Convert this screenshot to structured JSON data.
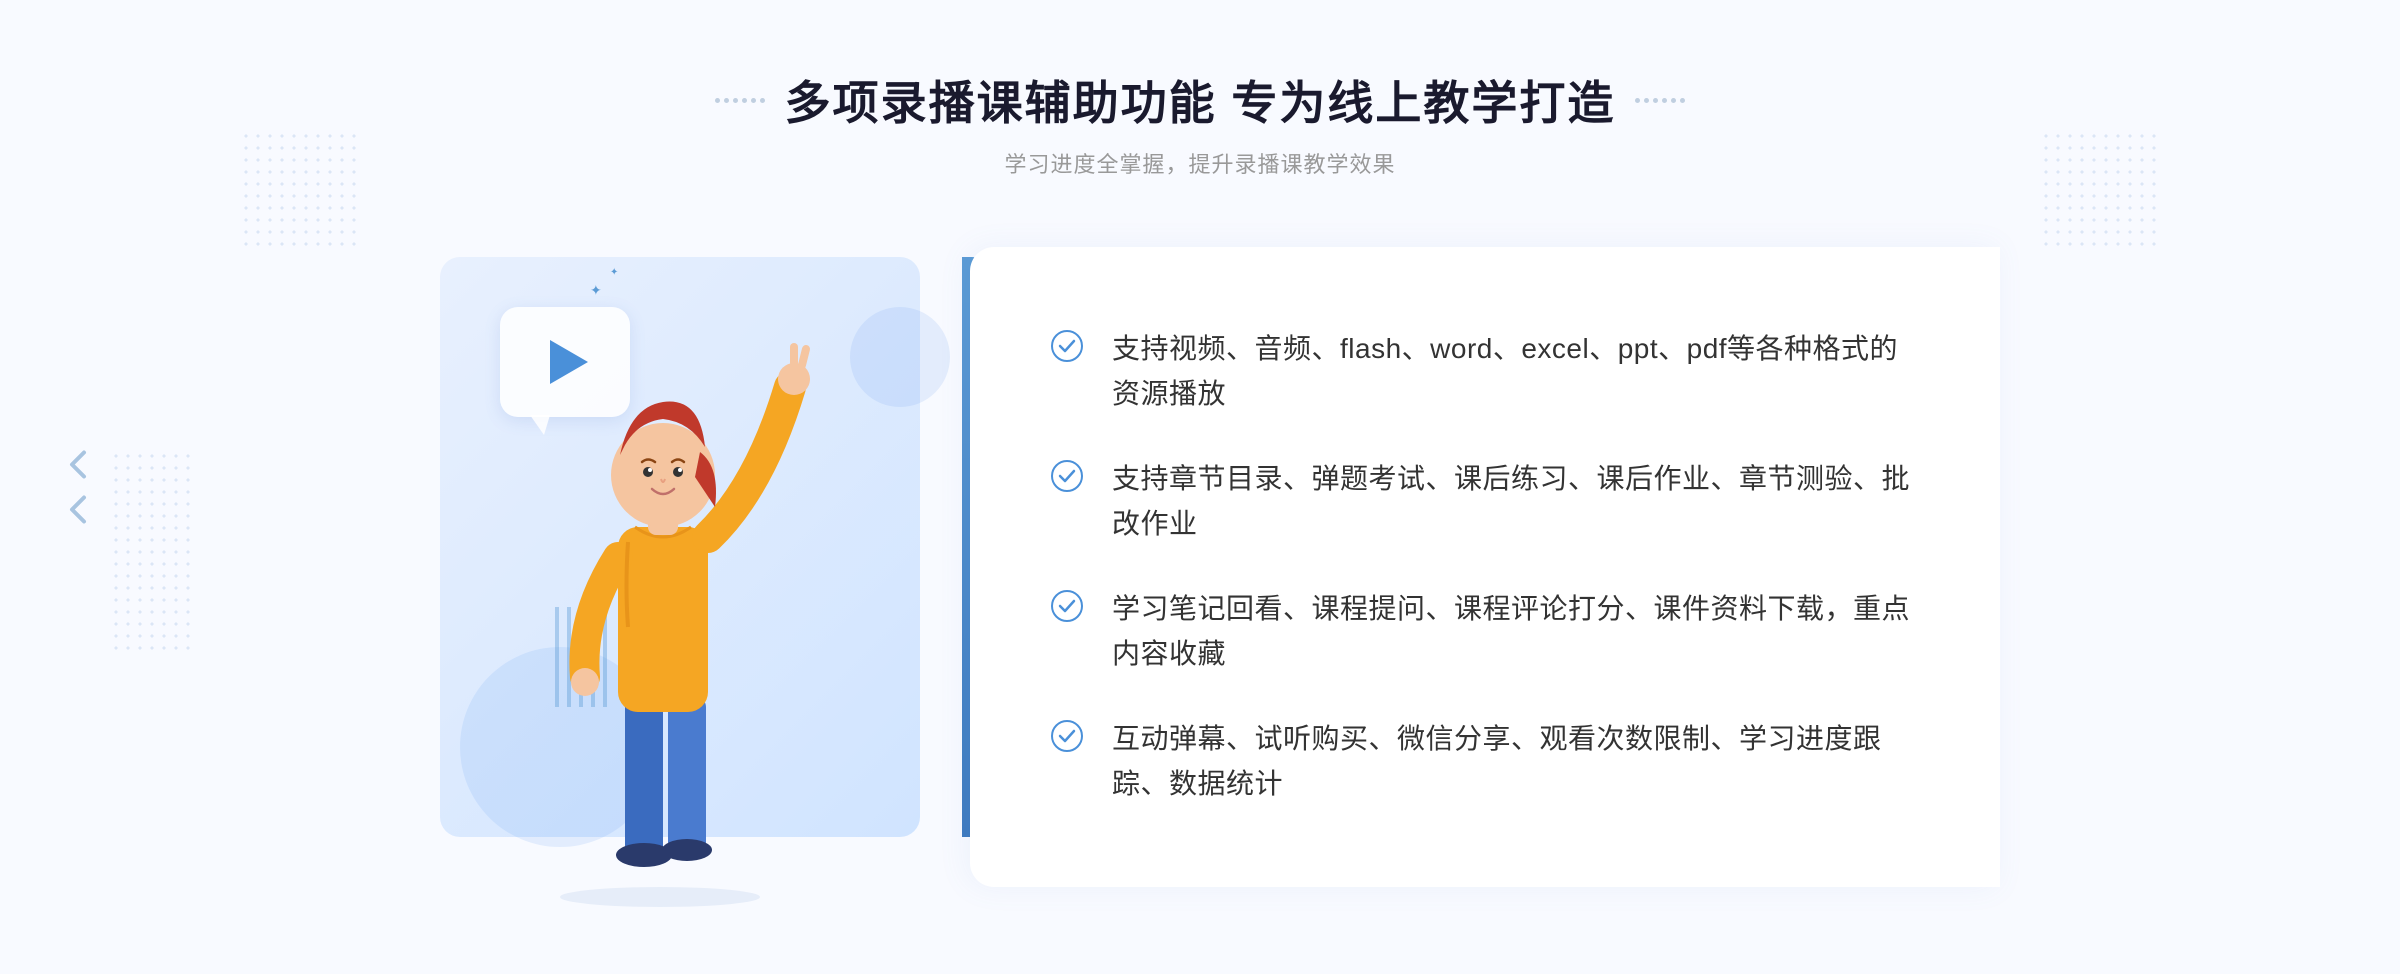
{
  "header": {
    "main_title": "多项录播课辅助功能 专为线上教学打造",
    "subtitle": "学习进度全掌握，提升录播课教学效果"
  },
  "features": [
    {
      "id": 1,
      "text": "支持视频、音频、flash、word、excel、ppt、pdf等各种格式的资源播放"
    },
    {
      "id": 2,
      "text": "支持章节目录、弹题考试、课后练习、课后作业、章节测验、批改作业"
    },
    {
      "id": 3,
      "text": "学习笔记回看、课程提问、课程评论打分、课件资料下载，重点内容收藏"
    },
    {
      "id": 4,
      "text": "互动弹幕、试听购买、微信分享、观看次数限制、学习进度跟踪、数据统计"
    }
  ],
  "colors": {
    "accent_blue": "#4a90d9",
    "light_blue": "#5b9bd5",
    "title_dark": "#1a1a2e",
    "text_gray": "#333333",
    "subtitle_gray": "#999999",
    "bg_light": "#f8faff"
  }
}
